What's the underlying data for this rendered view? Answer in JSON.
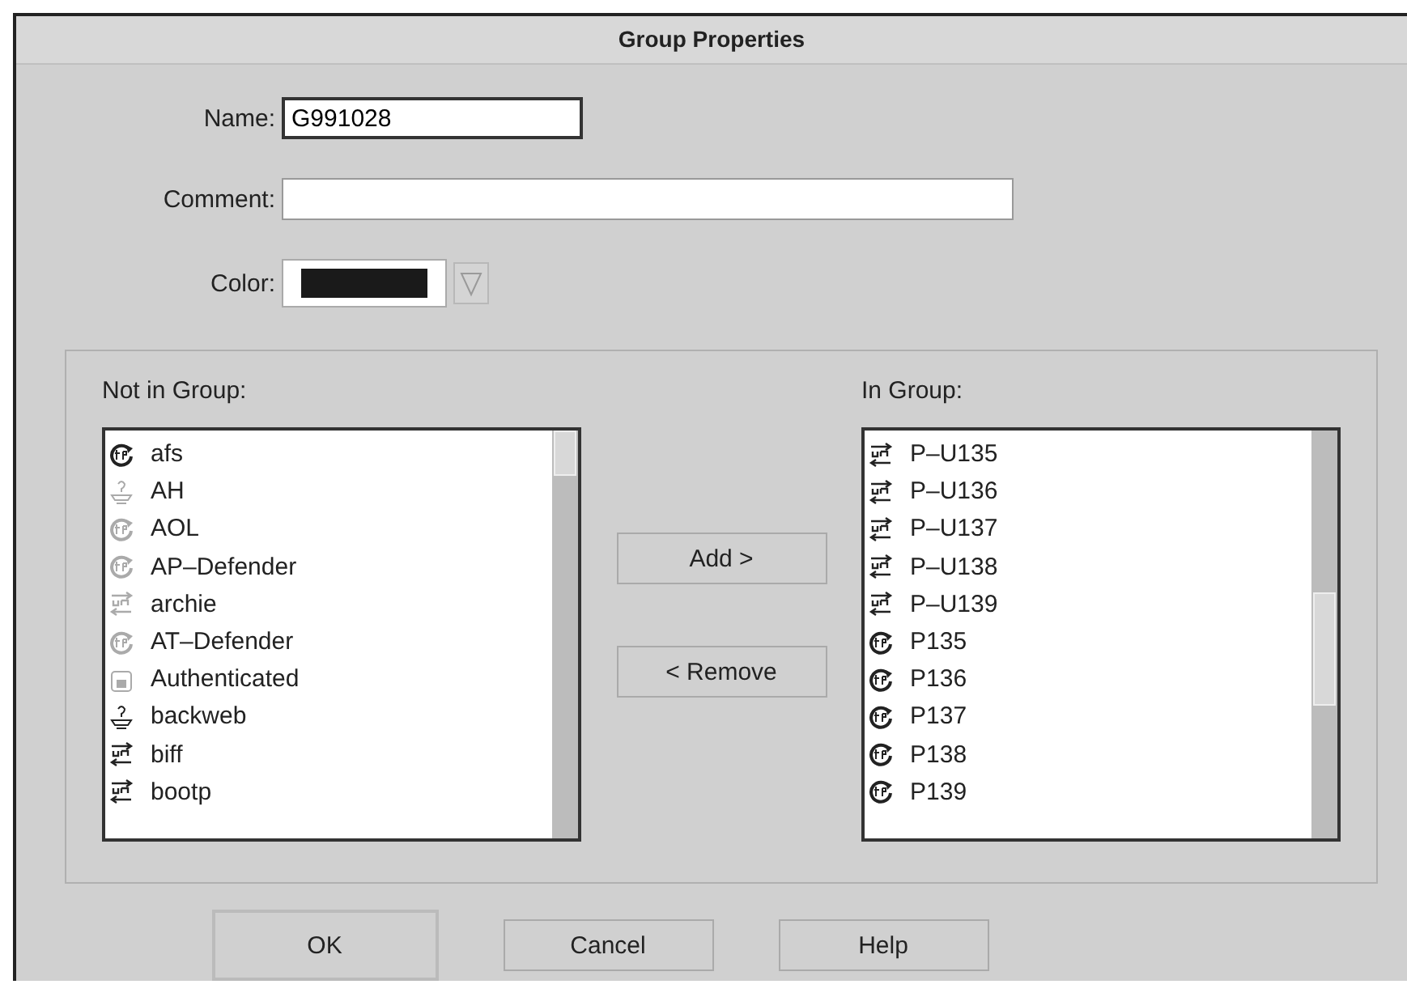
{
  "window": {
    "title": "Group Properties"
  },
  "fields": {
    "name": {
      "label": "Name:",
      "value": "G991028"
    },
    "comment": {
      "label": "Comment:"
    },
    "color": {
      "label": "Color:",
      "color": "#1a1a1a"
    }
  },
  "not_in_group": {
    "label": "Not in Group:",
    "items": [
      {
        "kind": "tcp",
        "label": "afs",
        "dimmed": false
      },
      {
        "kind": "unknown",
        "label": "AH",
        "dimmed": true
      },
      {
        "kind": "tcp",
        "label": "AOL",
        "dimmed": true
      },
      {
        "kind": "tcp",
        "label": "AP–Defender",
        "dimmed": true
      },
      {
        "kind": "udp",
        "label": "archie",
        "dimmed": true
      },
      {
        "kind": "tcp",
        "label": "AT–Defender",
        "dimmed": true
      },
      {
        "kind": "auth",
        "label": "Authenticated",
        "dimmed": true
      },
      {
        "kind": "unknown",
        "label": "backweb",
        "dimmed": false
      },
      {
        "kind": "udp",
        "label": "biff",
        "dimmed": false
      },
      {
        "kind": "udp",
        "label": "bootp",
        "dimmed": false
      }
    ]
  },
  "move_buttons": [
    "Add  >",
    "< Remove"
  ],
  "in_group": {
    "label": "In Group:",
    "items": [
      {
        "kind": "udp",
        "label": "P–U135",
        "dimmed": false
      },
      {
        "kind": "udp",
        "label": "P–U136",
        "dimmed": false
      },
      {
        "kind": "udp",
        "label": "P–U137",
        "dimmed": false
      },
      {
        "kind": "udp",
        "label": "P–U138",
        "dimmed": false
      },
      {
        "kind": "udp",
        "label": "P–U139",
        "dimmed": false
      },
      {
        "kind": "tcp",
        "label": "P135",
        "dimmed": false
      },
      {
        "kind": "tcp",
        "label": "P136",
        "dimmed": false
      },
      {
        "kind": "tcp",
        "label": "P137",
        "dimmed": false
      },
      {
        "kind": "tcp",
        "label": "P138",
        "dimmed": false
      },
      {
        "kind": "tcp",
        "label": "P139",
        "dimmed": false
      }
    ]
  },
  "buttons": [
    "OK",
    "Cancel",
    "Help"
  ]
}
